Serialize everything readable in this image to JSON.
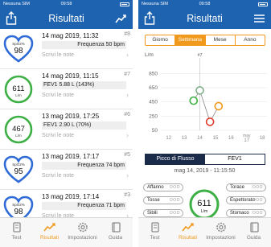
{
  "status": {
    "carrier": "Nessuna SIM",
    "time": "09:58"
  },
  "left": {
    "title": "Risultati",
    "items": [
      {
        "num": "#8",
        "date": "14 mag 2019, 11:32",
        "value": "Frequenza 50 bpm",
        "note": "Scrivi le note",
        "badge_type": "heart",
        "badge_label": "SpO2%",
        "badge_value": "98",
        "badge_unit": "",
        "color": "#2e6bd6"
      },
      {
        "num": "#7",
        "date": "14 mag 2019, 11:15",
        "value": "FEV1 5.88 L (143%)",
        "note": "Scrivi le note",
        "badge_type": "circle",
        "badge_label": "",
        "badge_value": "611",
        "badge_unit": "L/m",
        "color": "#3cb044"
      },
      {
        "num": "#6",
        "date": "13 mag 2019, 17:25",
        "value": "FEV1 2.90 L (70%)",
        "note": "Scrivi le note",
        "badge_type": "circle",
        "badge_label": "",
        "badge_value": "467",
        "badge_unit": "L/m",
        "color": "#3cb044"
      },
      {
        "num": "#5",
        "date": "13 mag 2019, 17:17",
        "value": "Frequenza 74 bpm",
        "note": "Scrivi le note",
        "badge_type": "heart",
        "badge_label": "SpO2%",
        "badge_value": "95",
        "badge_unit": "",
        "color": "#2e6bd6"
      },
      {
        "num": "#3",
        "date": "13 mag 2019, 17:14",
        "value": "Frequenza 71 bpm",
        "note": "Scrivi le note",
        "badge_type": "heart",
        "badge_label": "SpO2%",
        "badge_value": "98",
        "badge_unit": "",
        "color": "#2e6bd6"
      }
    ]
  },
  "tabs": [
    {
      "label": "Test",
      "icon": "test-icon",
      "active": false
    },
    {
      "label": "Risultati",
      "icon": "results-chart-icon",
      "active": true
    },
    {
      "label": "Impostazioni",
      "icon": "settings-gear-icon",
      "active": false
    },
    {
      "label": "Guida",
      "icon": "guide-book-icon",
      "active": false
    }
  ],
  "right": {
    "title": "Risultati",
    "segments": [
      "Giorno",
      "Settimana",
      "Mese",
      "Anno"
    ],
    "active_segment": "Settimana",
    "toggle": [
      "Picco di Flusso",
      "FEV1"
    ],
    "active_toggle": "Picco di Flusso",
    "detail_date": "mag 14, 2019 - 11:15:50",
    "symptoms_left": [
      "Affanno",
      "Tosse",
      "Sibili"
    ],
    "symptoms_right": [
      "Torace",
      "Espettorato",
      "Stomaco"
    ],
    "symptom_dots": "OOO",
    "badge_value": "611",
    "badge_unit": "L/m",
    "badge_color": "#3cb044"
  },
  "chart_data": {
    "type": "scatter",
    "ylabel": "L/m",
    "yticks": [
      50,
      250,
      450,
      650,
      850
    ],
    "ylim": [
      50,
      1000
    ],
    "xlim": [
      11.5,
      18.3
    ],
    "xticks": [
      "12",
      "13",
      "14",
      "15",
      "16",
      "may\n17",
      "18"
    ],
    "marker_label": "#7",
    "marker_x": 14,
    "points": [
      {
        "x": 13.6,
        "y": 467,
        "color": "#3cb044"
      },
      {
        "x": 14.0,
        "y": 611,
        "color": "#7fb08a"
      },
      {
        "x": 14.65,
        "y": 170,
        "color": "#e23b2a"
      },
      {
        "x": 15.2,
        "y": 390,
        "color": "#f0991c"
      }
    ],
    "grid": true
  }
}
